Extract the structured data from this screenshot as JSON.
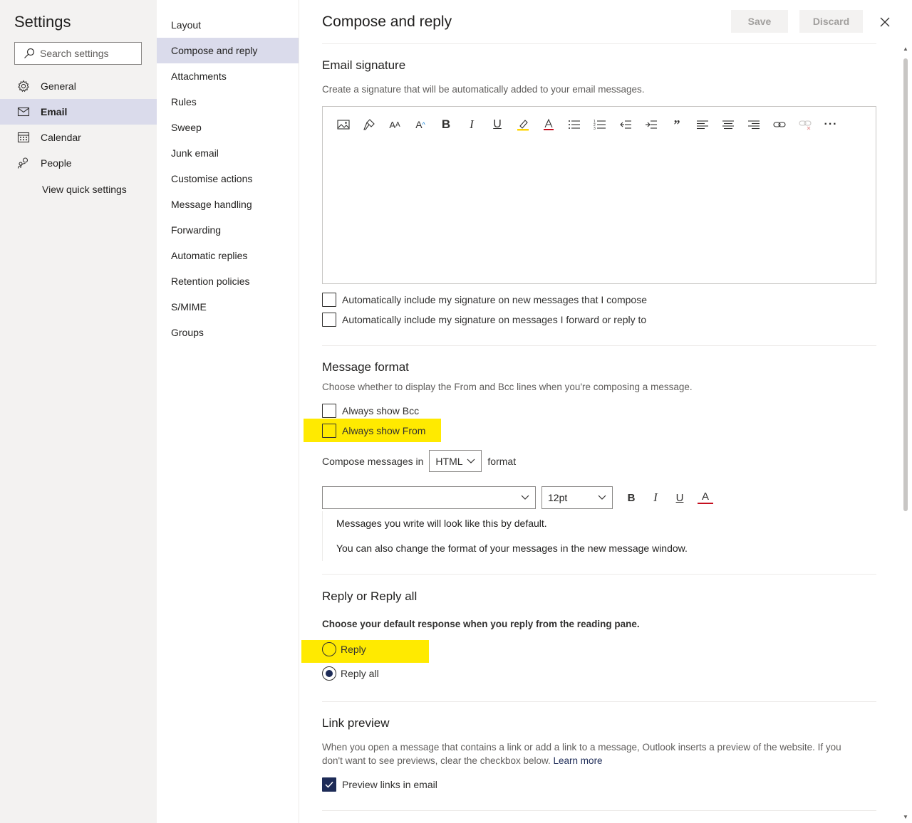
{
  "sidebar": {
    "title": "Settings",
    "search_placeholder": "Search settings",
    "items": [
      {
        "label": "General",
        "icon": "gear-icon"
      },
      {
        "label": "Email",
        "icon": "mail-icon"
      },
      {
        "label": "Calendar",
        "icon": "calendar-icon"
      },
      {
        "label": "People",
        "icon": "people-icon"
      }
    ],
    "selected": "Email",
    "quick_settings_link": "View quick settings"
  },
  "subnav": {
    "items": [
      "Layout",
      "Compose and reply",
      "Attachments",
      "Rules",
      "Sweep",
      "Junk email",
      "Customise actions",
      "Message handling",
      "Forwarding",
      "Automatic replies",
      "Retention policies",
      "S/MIME",
      "Groups"
    ],
    "selected": "Compose and reply"
  },
  "page": {
    "title": "Compose and reply",
    "save_label": "Save",
    "discard_label": "Discard"
  },
  "signature": {
    "heading": "Email signature",
    "description": "Create a signature that will be automatically added to your email messages.",
    "toolbar_icons": [
      "insert-picture-icon",
      "format-painter-icon",
      "font-size-icon",
      "grow-font-icon",
      "bold-icon",
      "italic-icon",
      "underline-icon",
      "highlight-icon",
      "font-color-icon",
      "bullets-icon",
      "numbering-icon",
      "decrease-indent-icon",
      "increase-indent-icon",
      "quote-icon",
      "align-left-icon",
      "align-center-icon",
      "align-right-icon",
      "insert-link-icon",
      "remove-link-icon",
      "more-options-icon"
    ],
    "auto_new_label": "Automatically include my signature on new messages that I compose",
    "auto_new_checked": false,
    "auto_reply_label": "Automatically include my signature on messages I forward or reply to",
    "auto_reply_checked": false
  },
  "message_format": {
    "heading": "Message format",
    "description": "Choose whether to display the From and Bcc lines when you're composing a message.",
    "show_bcc_label": "Always show Bcc",
    "show_bcc_checked": false,
    "show_from_label": "Always show From",
    "show_from_checked": false,
    "compose_prefix": "Compose messages in",
    "compose_value": "HTML",
    "compose_suffix": "format",
    "font_value": "",
    "size_value": "12pt",
    "bold_glyph": "B",
    "italic_glyph": "I",
    "underline_glyph": "U",
    "color_glyph": "A",
    "preview_line1": "Messages you write will look like this by default.",
    "preview_line2": "You can also change the format of your messages in the new message window."
  },
  "reply": {
    "heading": "Reply or Reply all",
    "description": "Choose your default response when you reply from the reading pane.",
    "options": [
      "Reply",
      "Reply all"
    ],
    "selected": "Reply all"
  },
  "link_preview": {
    "heading": "Link preview",
    "description_line1": "When you open a message that contains a link or add a link to a message, Outlook inserts a preview of the website. If you",
    "description_line2": "don't want to see previews, clear the checkbox below.",
    "learn_more": "Learn more",
    "checkbox_label": "Preview links in email",
    "checked": true
  },
  "colors": {
    "highlight": "#ffea00",
    "selected_nav": "#dadbeb",
    "accent": "#1d2b57",
    "sidebar_bg": "#f3f2f1"
  }
}
